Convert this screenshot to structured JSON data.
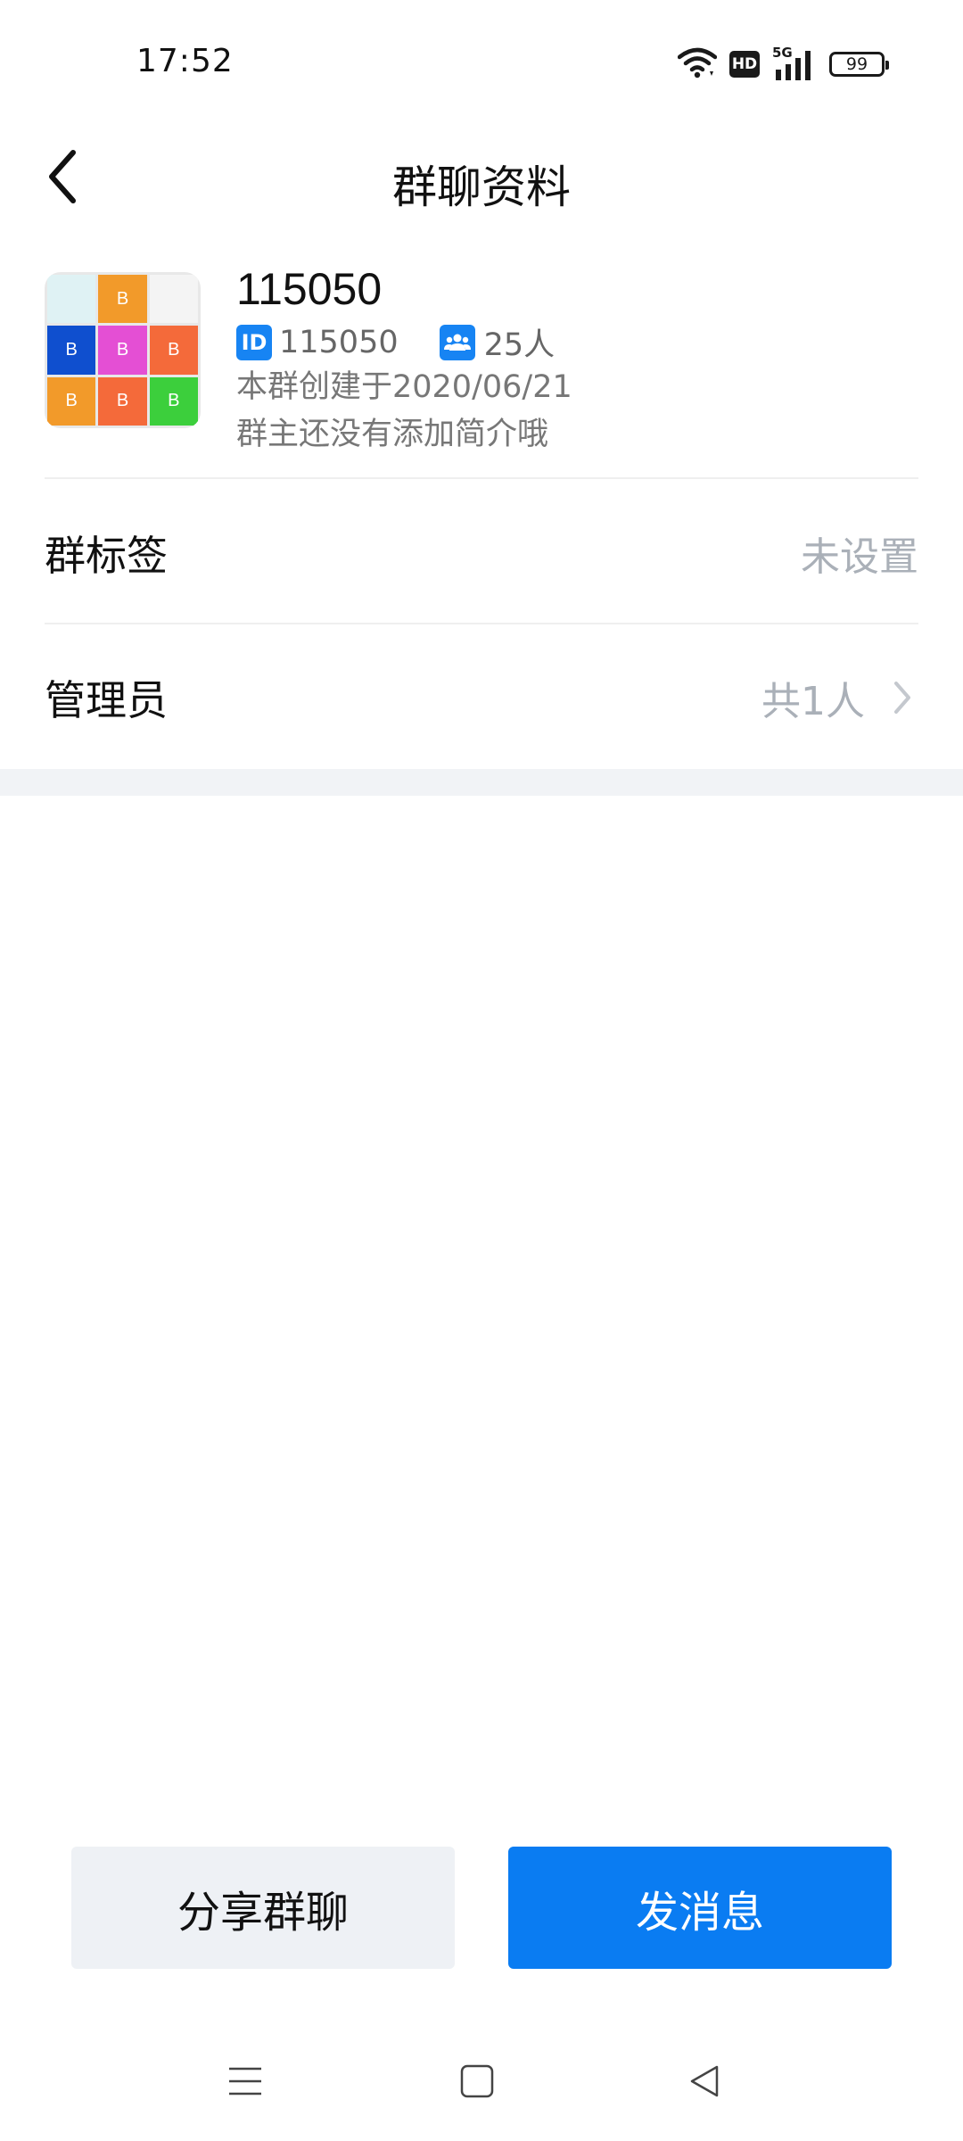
{
  "status_bar": {
    "time": "17:52",
    "network": "5G",
    "hd_label": "HD",
    "battery": "99"
  },
  "header": {
    "title": "群聊资料"
  },
  "group": {
    "name": "115050",
    "id_badge": "ID",
    "id": "115050",
    "member_count": "25人",
    "created": "本群创建于2020/06/21",
    "intro": "群主还没有添加简介哦",
    "avatar_tiles": [
      {
        "label": "",
        "color": "#dff2f4"
      },
      {
        "label": "B",
        "color": "#f29a2a"
      },
      {
        "label": "",
        "color": "#f4f4f4"
      },
      {
        "label": "B",
        "color": "#0f4fcf"
      },
      {
        "label": "B",
        "color": "#e44fd4"
      },
      {
        "label": "B",
        "color": "#f46a3a"
      },
      {
        "label": "B",
        "color": "#f29a2a"
      },
      {
        "label": "B",
        "color": "#f46a3a"
      },
      {
        "label": "B",
        "color": "#3ccf3c"
      }
    ]
  },
  "settings": {
    "tags_label": "群标签",
    "tags_value": "未设置",
    "admin_label": "管理员",
    "admin_value": "共1人"
  },
  "actions": {
    "share_label": "分享群聊",
    "send_label": "发消息"
  },
  "colors": {
    "accent": "#0a7cf2",
    "badge": "#1784f3",
    "muted": "#aab0b8"
  },
  "icons": {
    "back": "chevron-left-icon",
    "wifi": "wifi-icon",
    "signal": "signal-icon",
    "members": "people-icon",
    "chevron": "chevron-right-icon",
    "nav_menu": "menu-icon",
    "nav_home": "home-icon",
    "nav_back": "back-triangle-icon"
  }
}
